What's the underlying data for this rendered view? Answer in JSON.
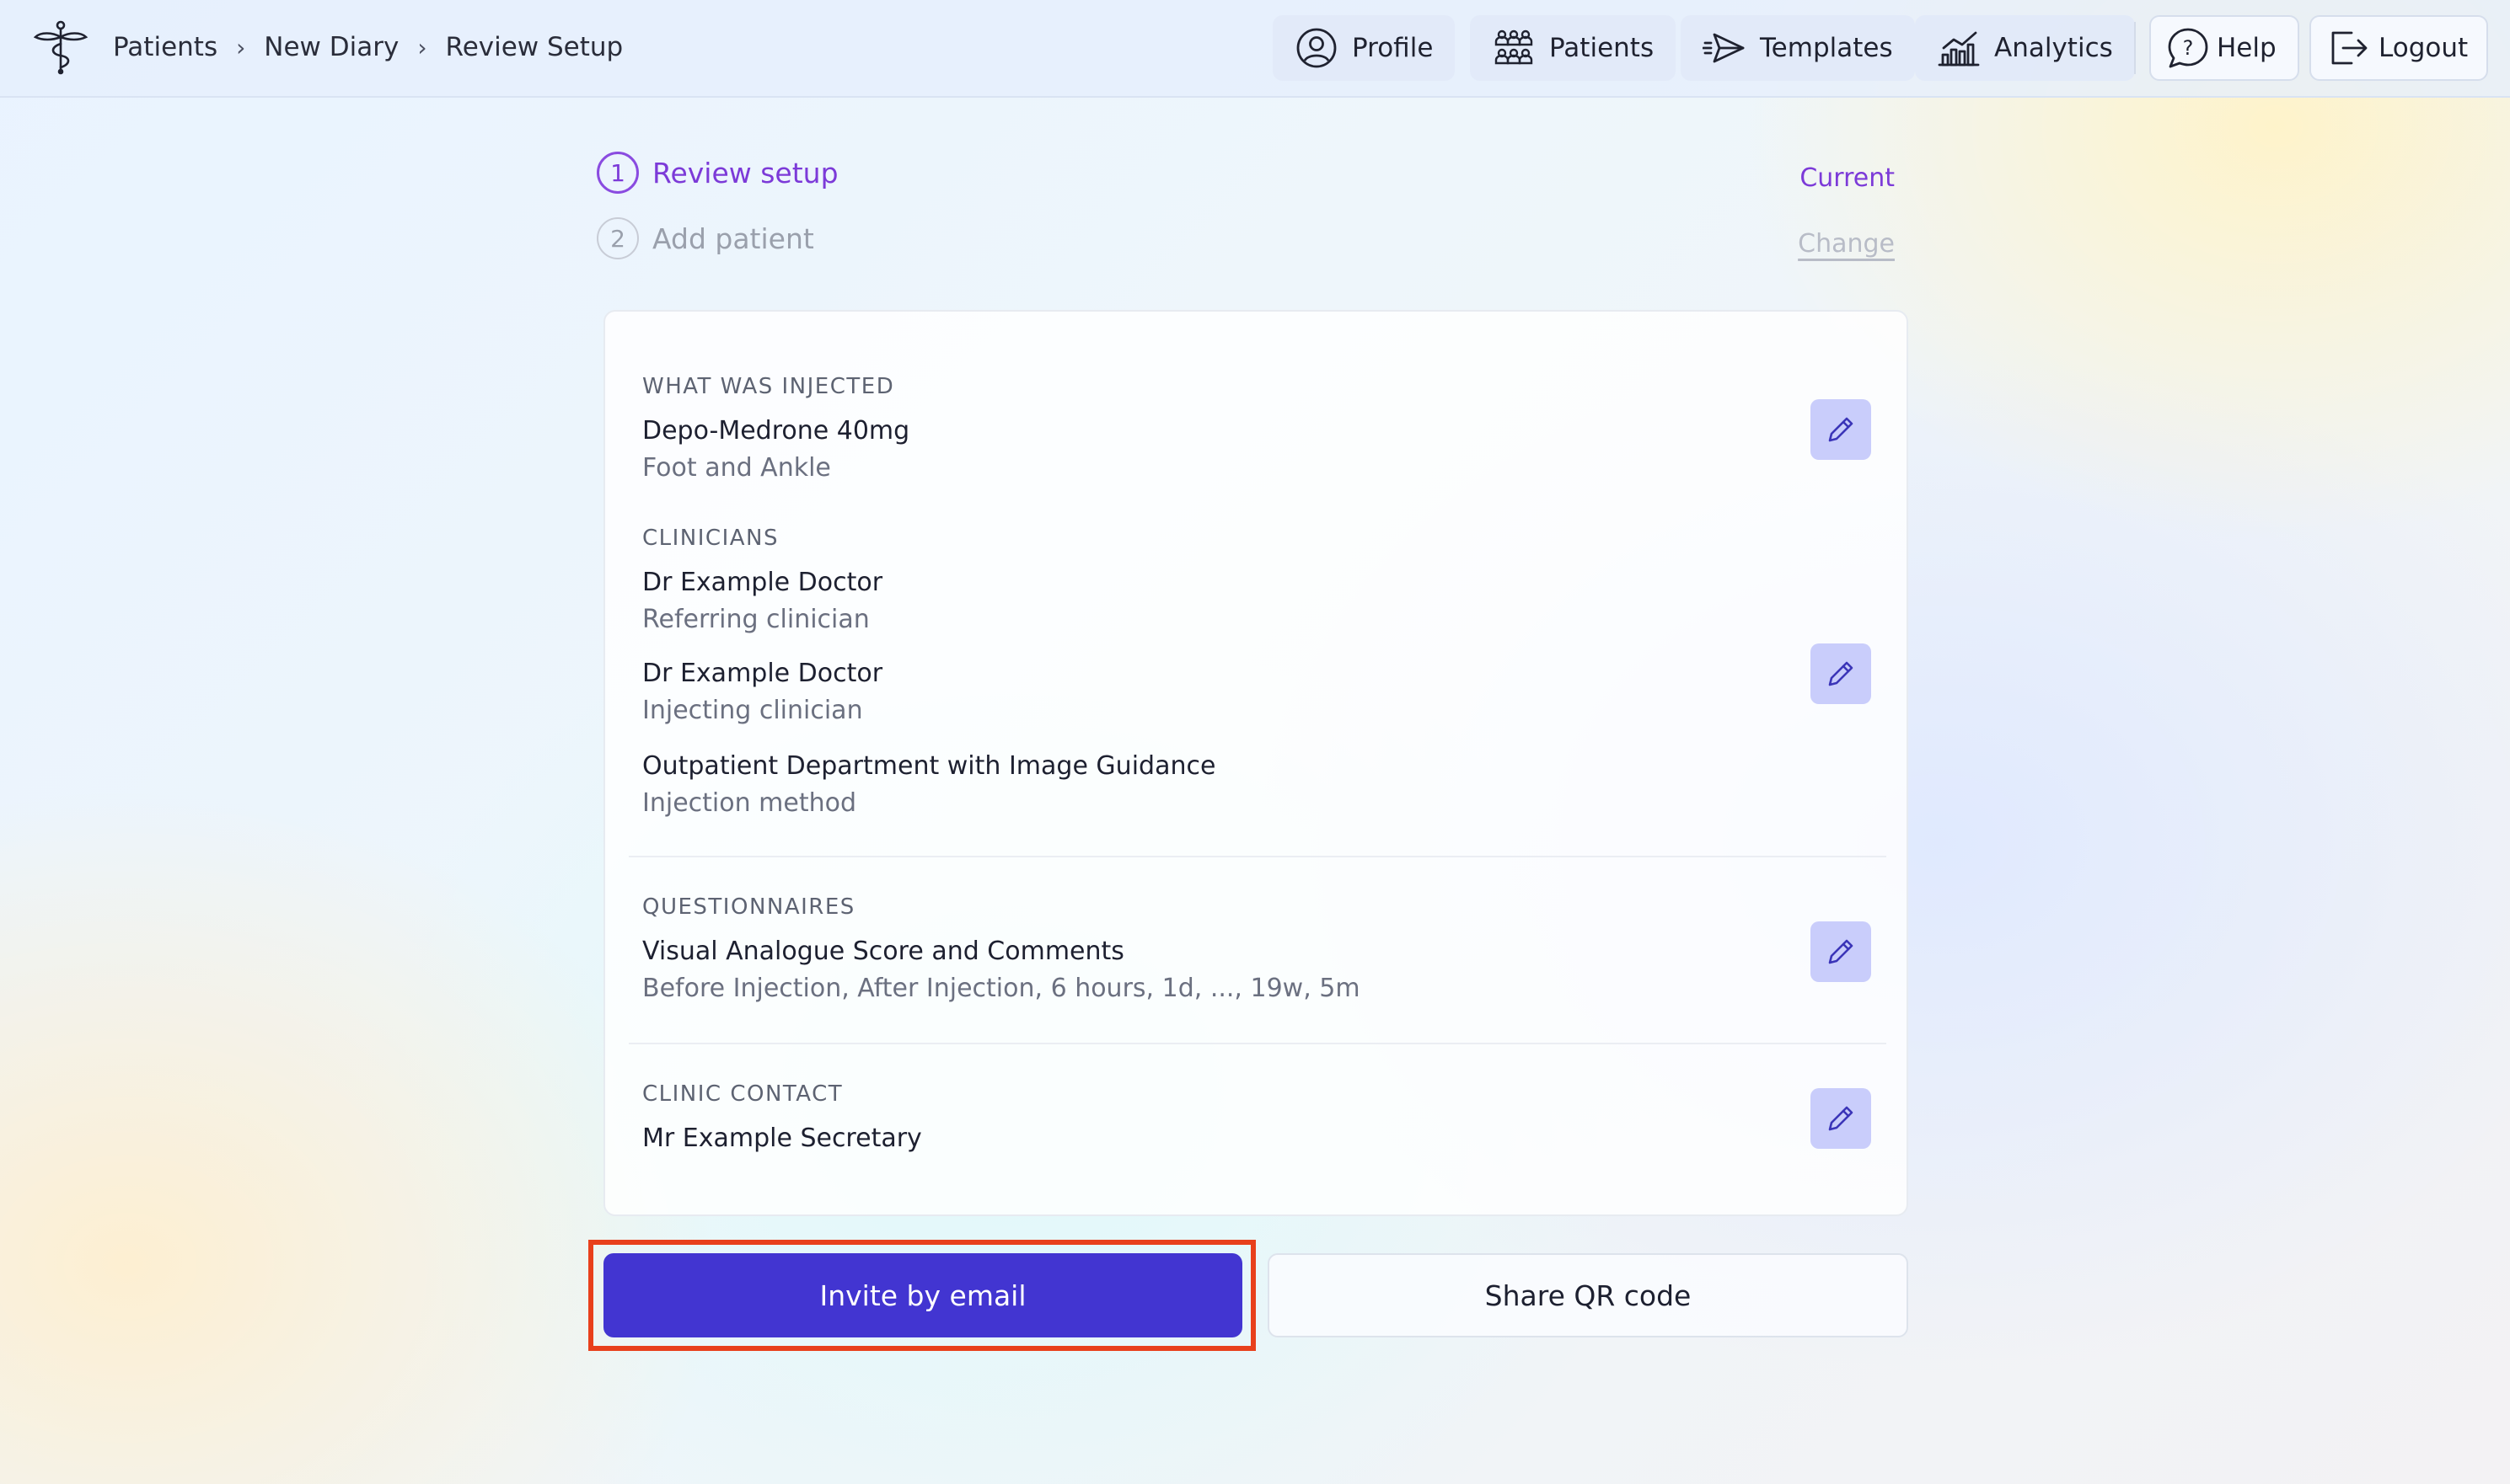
{
  "breadcrumb": [
    "Patients",
    "New Diary",
    "Review Setup"
  ],
  "nav": {
    "profile": "Profile",
    "patients": "Patients",
    "templates": "Templates",
    "analytics": "Analytics",
    "help": "Help",
    "logout": "Logout"
  },
  "steps": [
    {
      "number": "1",
      "label": "Review setup",
      "status": "Current"
    },
    {
      "number": "2",
      "label": "Add patient",
      "status": "Change"
    }
  ],
  "sections": {
    "injected": {
      "label": "WHAT WAS INJECTED",
      "drug": "Depo-Medrone 40mg",
      "site": "Foot and Ankle"
    },
    "clinicians": {
      "label": "CLINICIANS",
      "items": [
        {
          "name": "Dr Example Doctor",
          "role": "Referring clinician"
        },
        {
          "name": "Dr Example Doctor",
          "role": "Injecting clinician"
        },
        {
          "name": "Outpatient Department with Image Guidance",
          "role": "Injection method"
        }
      ]
    },
    "questionnaires": {
      "label": "QUESTIONNAIRES",
      "name": "Visual Analogue Score and Comments",
      "schedule": "Before Injection, After Injection, 6 hours, 1d, ..., 19w, 5m"
    },
    "contact": {
      "label": "CLINIC CONTACT",
      "name": "Mr Example Secretary"
    }
  },
  "actions": {
    "invite": "Invite by email",
    "qr": "Share QR code"
  },
  "colors": {
    "accent": "#7c3ad8",
    "primary_button": "#4235d1",
    "edit_button_bg": "#c9cdfb",
    "highlight": "#e8401c"
  },
  "icons": {
    "logo": "caduceus-logo",
    "profile": "user-circle-icon",
    "patients": "people-group-icon",
    "templates": "paper-plane-icon",
    "analytics": "bar-chart-icon",
    "help": "question-bubble-icon",
    "logout": "logout-icon",
    "edit": "pencil-icon"
  }
}
